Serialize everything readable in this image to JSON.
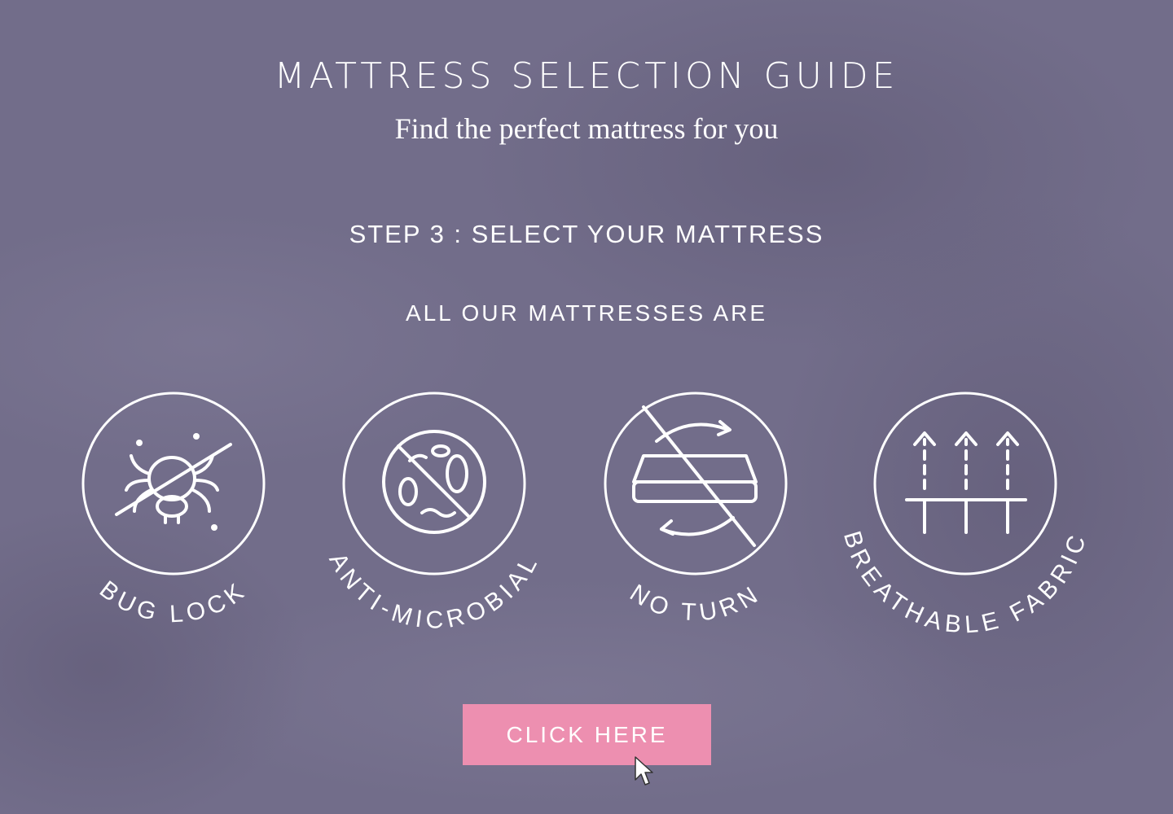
{
  "header": {
    "title": "MATTRESS SELECTION GUIDE",
    "subtitle": "Find the perfect mattress for you"
  },
  "step": {
    "label": "STEP 3 : SELECT YOUR MATTRESS"
  },
  "features_intro": "ALL OUR MATTRESSES ARE",
  "features": [
    {
      "label": "BUG LOCK",
      "icon": "bug-lock-icon"
    },
    {
      "label": "ANTI-MICROBIAL",
      "icon": "anti-microbial-icon"
    },
    {
      "label": "NO TURN",
      "icon": "no-turn-icon"
    },
    {
      "label": "BREATHABLE FABRIC",
      "icon": "breathable-fabric-icon"
    }
  ],
  "cta": {
    "label": "CLICK HERE"
  },
  "colors": {
    "background": "#726d8a",
    "button": "#ed8fb0",
    "text": "#ffffff"
  }
}
